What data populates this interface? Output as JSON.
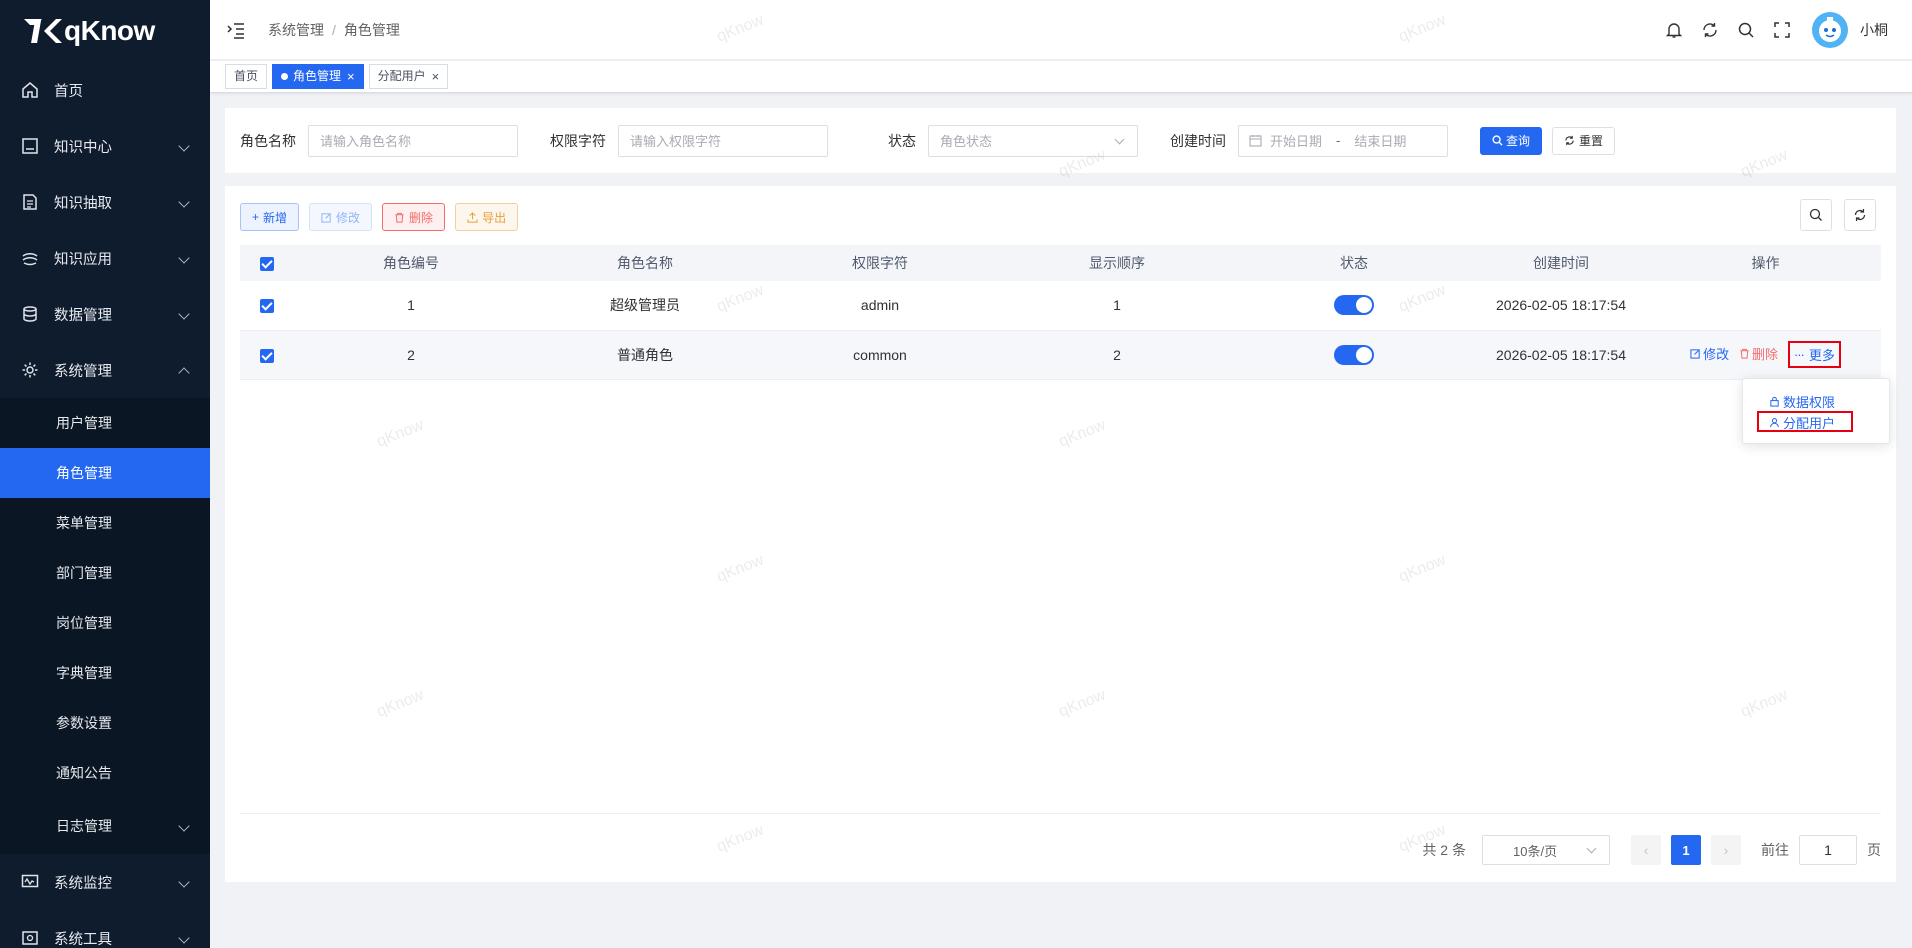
{
  "app": {
    "name": "qKnow"
  },
  "sidebar": {
    "items": [
      {
        "label": "首页",
        "icon": "home-icon",
        "expandable": false
      },
      {
        "label": "知识中心",
        "icon": "document-icon",
        "expandable": true
      },
      {
        "label": "知识抽取",
        "icon": "file-text-icon",
        "expandable": true
      },
      {
        "label": "知识应用",
        "icon": "layers-icon",
        "expandable": true
      },
      {
        "label": "数据管理",
        "icon": "database-icon",
        "expandable": true
      },
      {
        "label": "系统管理",
        "icon": "gear-icon",
        "expandable": true,
        "expanded": true
      }
    ],
    "submenu": [
      {
        "label": "用户管理"
      },
      {
        "label": "角色管理",
        "active": true
      },
      {
        "label": "菜单管理"
      },
      {
        "label": "部门管理"
      },
      {
        "label": "岗位管理"
      },
      {
        "label": "字典管理"
      },
      {
        "label": "参数设置"
      },
      {
        "label": "通知公告"
      },
      {
        "label": "日志管理",
        "expandable": true
      }
    ],
    "bottom_items": [
      {
        "label": "系统监控",
        "icon": "monitor-icon",
        "expandable": true
      },
      {
        "label": "系统工具",
        "icon": "tools-icon",
        "expandable": true
      }
    ]
  },
  "header": {
    "breadcrumb": [
      "系统管理",
      "角色管理"
    ],
    "username": "小桐"
  },
  "tags": [
    {
      "label": "首页",
      "active": false,
      "closable": false
    },
    {
      "label": "角色管理",
      "active": true,
      "closable": true
    },
    {
      "label": "分配用户",
      "active": false,
      "closable": true
    }
  ],
  "search": {
    "role_name_label": "角色名称",
    "role_name_placeholder": "请输入角色名称",
    "perm_label": "权限字符",
    "perm_placeholder": "请输入权限字符",
    "status_label": "状态",
    "status_placeholder": "角色状态",
    "time_label": "创建时间",
    "start_placeholder": "开始日期",
    "range_sep": "-",
    "end_placeholder": "结束日期",
    "query_btn": "查询",
    "reset_btn": "重置"
  },
  "toolbar": {
    "add": "新增",
    "edit": "修改",
    "delete": "删除",
    "export": "导出"
  },
  "table": {
    "columns": [
      "角色编号",
      "角色名称",
      "权限字符",
      "显示顺序",
      "状态",
      "创建时间",
      "操作"
    ],
    "rows": [
      {
        "id": "1",
        "name": "超级管理员",
        "key": "admin",
        "order": "1",
        "status": true,
        "created": "2026-02-05 18:17:54",
        "has_actions": false
      },
      {
        "id": "2",
        "name": "普通角色",
        "key": "common",
        "order": "2",
        "status": true,
        "created": "2026-02-05 18:17:54",
        "has_actions": true
      }
    ],
    "actions": {
      "edit": "修改",
      "delete": "删除",
      "more": "更多"
    }
  },
  "dropdown": {
    "items": [
      "数据权限",
      "分配用户"
    ],
    "highlighted": "分配用户"
  },
  "pagination": {
    "total_text": "共 2 条",
    "page_size": "10条/页",
    "current_page": "1",
    "goto_label": "前往",
    "goto_value": "1",
    "page_unit": "页"
  },
  "watermark": "qKnow",
  "colors": {
    "primary": "#2468f2",
    "danger": "#f56c6c",
    "warning": "#e6a23c",
    "sidebar": "#0f1c2e",
    "highlight_box": "#e60012"
  }
}
